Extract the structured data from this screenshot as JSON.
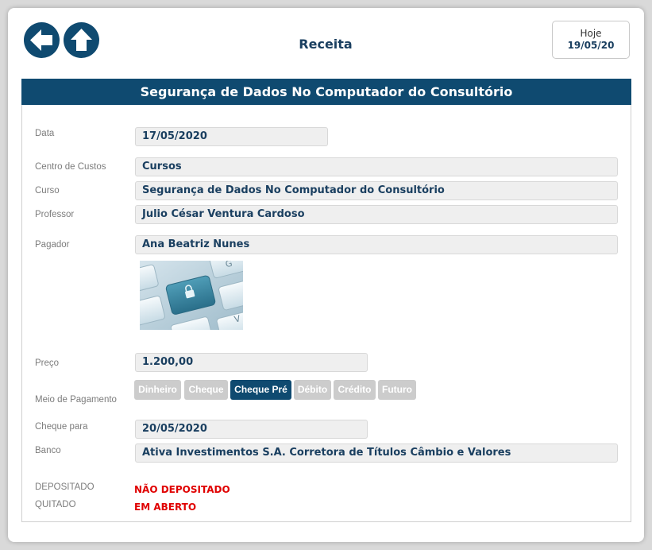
{
  "header": {
    "title": "Receita",
    "today_label": "Hoje",
    "today_date": "19/05/20",
    "back_icon": "arrow-left-icon",
    "home_icon": "arrow-up-icon"
  },
  "panel": {
    "title": "Segurança de Dados No Computador do Consultório"
  },
  "fields": {
    "data": {
      "label": "Data",
      "value": "17/05/2020"
    },
    "centro_custos": {
      "label": "Centro de Custos",
      "value": "Cursos"
    },
    "curso": {
      "label": "Curso",
      "value": "Segurança de Dados No Computador do Consultório"
    },
    "professor": {
      "label": "Professor",
      "value": "Julio César Ventura Cardoso"
    },
    "pagador": {
      "label": "Pagador",
      "value": "Ana Beatriz Nunes"
    },
    "preco": {
      "label": "Preço",
      "value": "1.200,00"
    },
    "cheque_para": {
      "label": "Cheque para",
      "value": "20/05/2020"
    },
    "banco": {
      "label": "Banco",
      "value": "Ativa Investimentos S.A. Corretora de Títulos Câmbio e Valores"
    }
  },
  "payment": {
    "label": "Meio de Pagamento",
    "options": [
      "Dinheiro",
      "Cheque",
      "Cheque Pré",
      "Débito",
      "Crédito",
      "Futuro"
    ],
    "selected": "Cheque Pré"
  },
  "status": {
    "depositado": {
      "label": "DEPOSITADO",
      "value": "NÃO DEPOSITADO"
    },
    "quitado": {
      "label": "QUITADO",
      "value": "EM ABERTO"
    }
  },
  "image": {
    "icon": "keyboard-lock-key-photo"
  },
  "colors": {
    "primary": "#0f4a70",
    "status_red": "#e00000",
    "inactive_option": "#cccccc"
  }
}
